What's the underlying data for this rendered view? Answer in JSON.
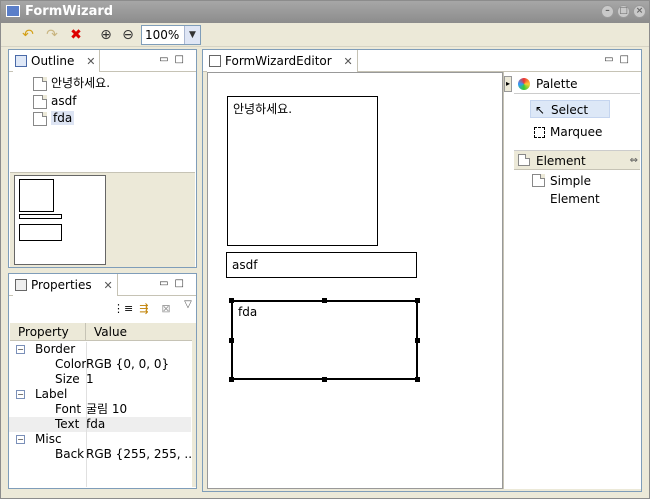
{
  "window": {
    "title": "FormWizard"
  },
  "toolbar": {
    "buttons": [
      "undo-icon",
      "redo-icon",
      "delete-icon",
      "zoom-in-icon",
      "zoom-out-icon"
    ],
    "zoom_value": "100%"
  },
  "outline": {
    "tab_label": "Outline",
    "items": [
      "안녕하세요.",
      "asdf",
      "fda"
    ]
  },
  "properties": {
    "tab_label": "Properties",
    "col_property": "Property",
    "col_value": "Value",
    "groups": {
      "border": "Border",
      "label": "Label",
      "misc": "Misc"
    },
    "rows": {
      "color_k": "Color",
      "color_v": "RGB {0, 0, 0}",
      "size_k": "Size",
      "size_v": "1",
      "font_k": "Font",
      "font_v": "굴림 10",
      "text_k": "Text",
      "text_v": "fda",
      "back_k": "Back",
      "back_v": "RGB {255, 255, ..."
    },
    "collapse_symbol": "⊟"
  },
  "editor": {
    "tab_label": "FormWizardEditor",
    "elements": [
      "안녕하세요.",
      "asdf",
      "fda"
    ]
  },
  "palette": {
    "title": "Palette",
    "select": "Select",
    "marquee": "Marquee",
    "element_header": "Element",
    "simple_element": "Simple Element"
  }
}
